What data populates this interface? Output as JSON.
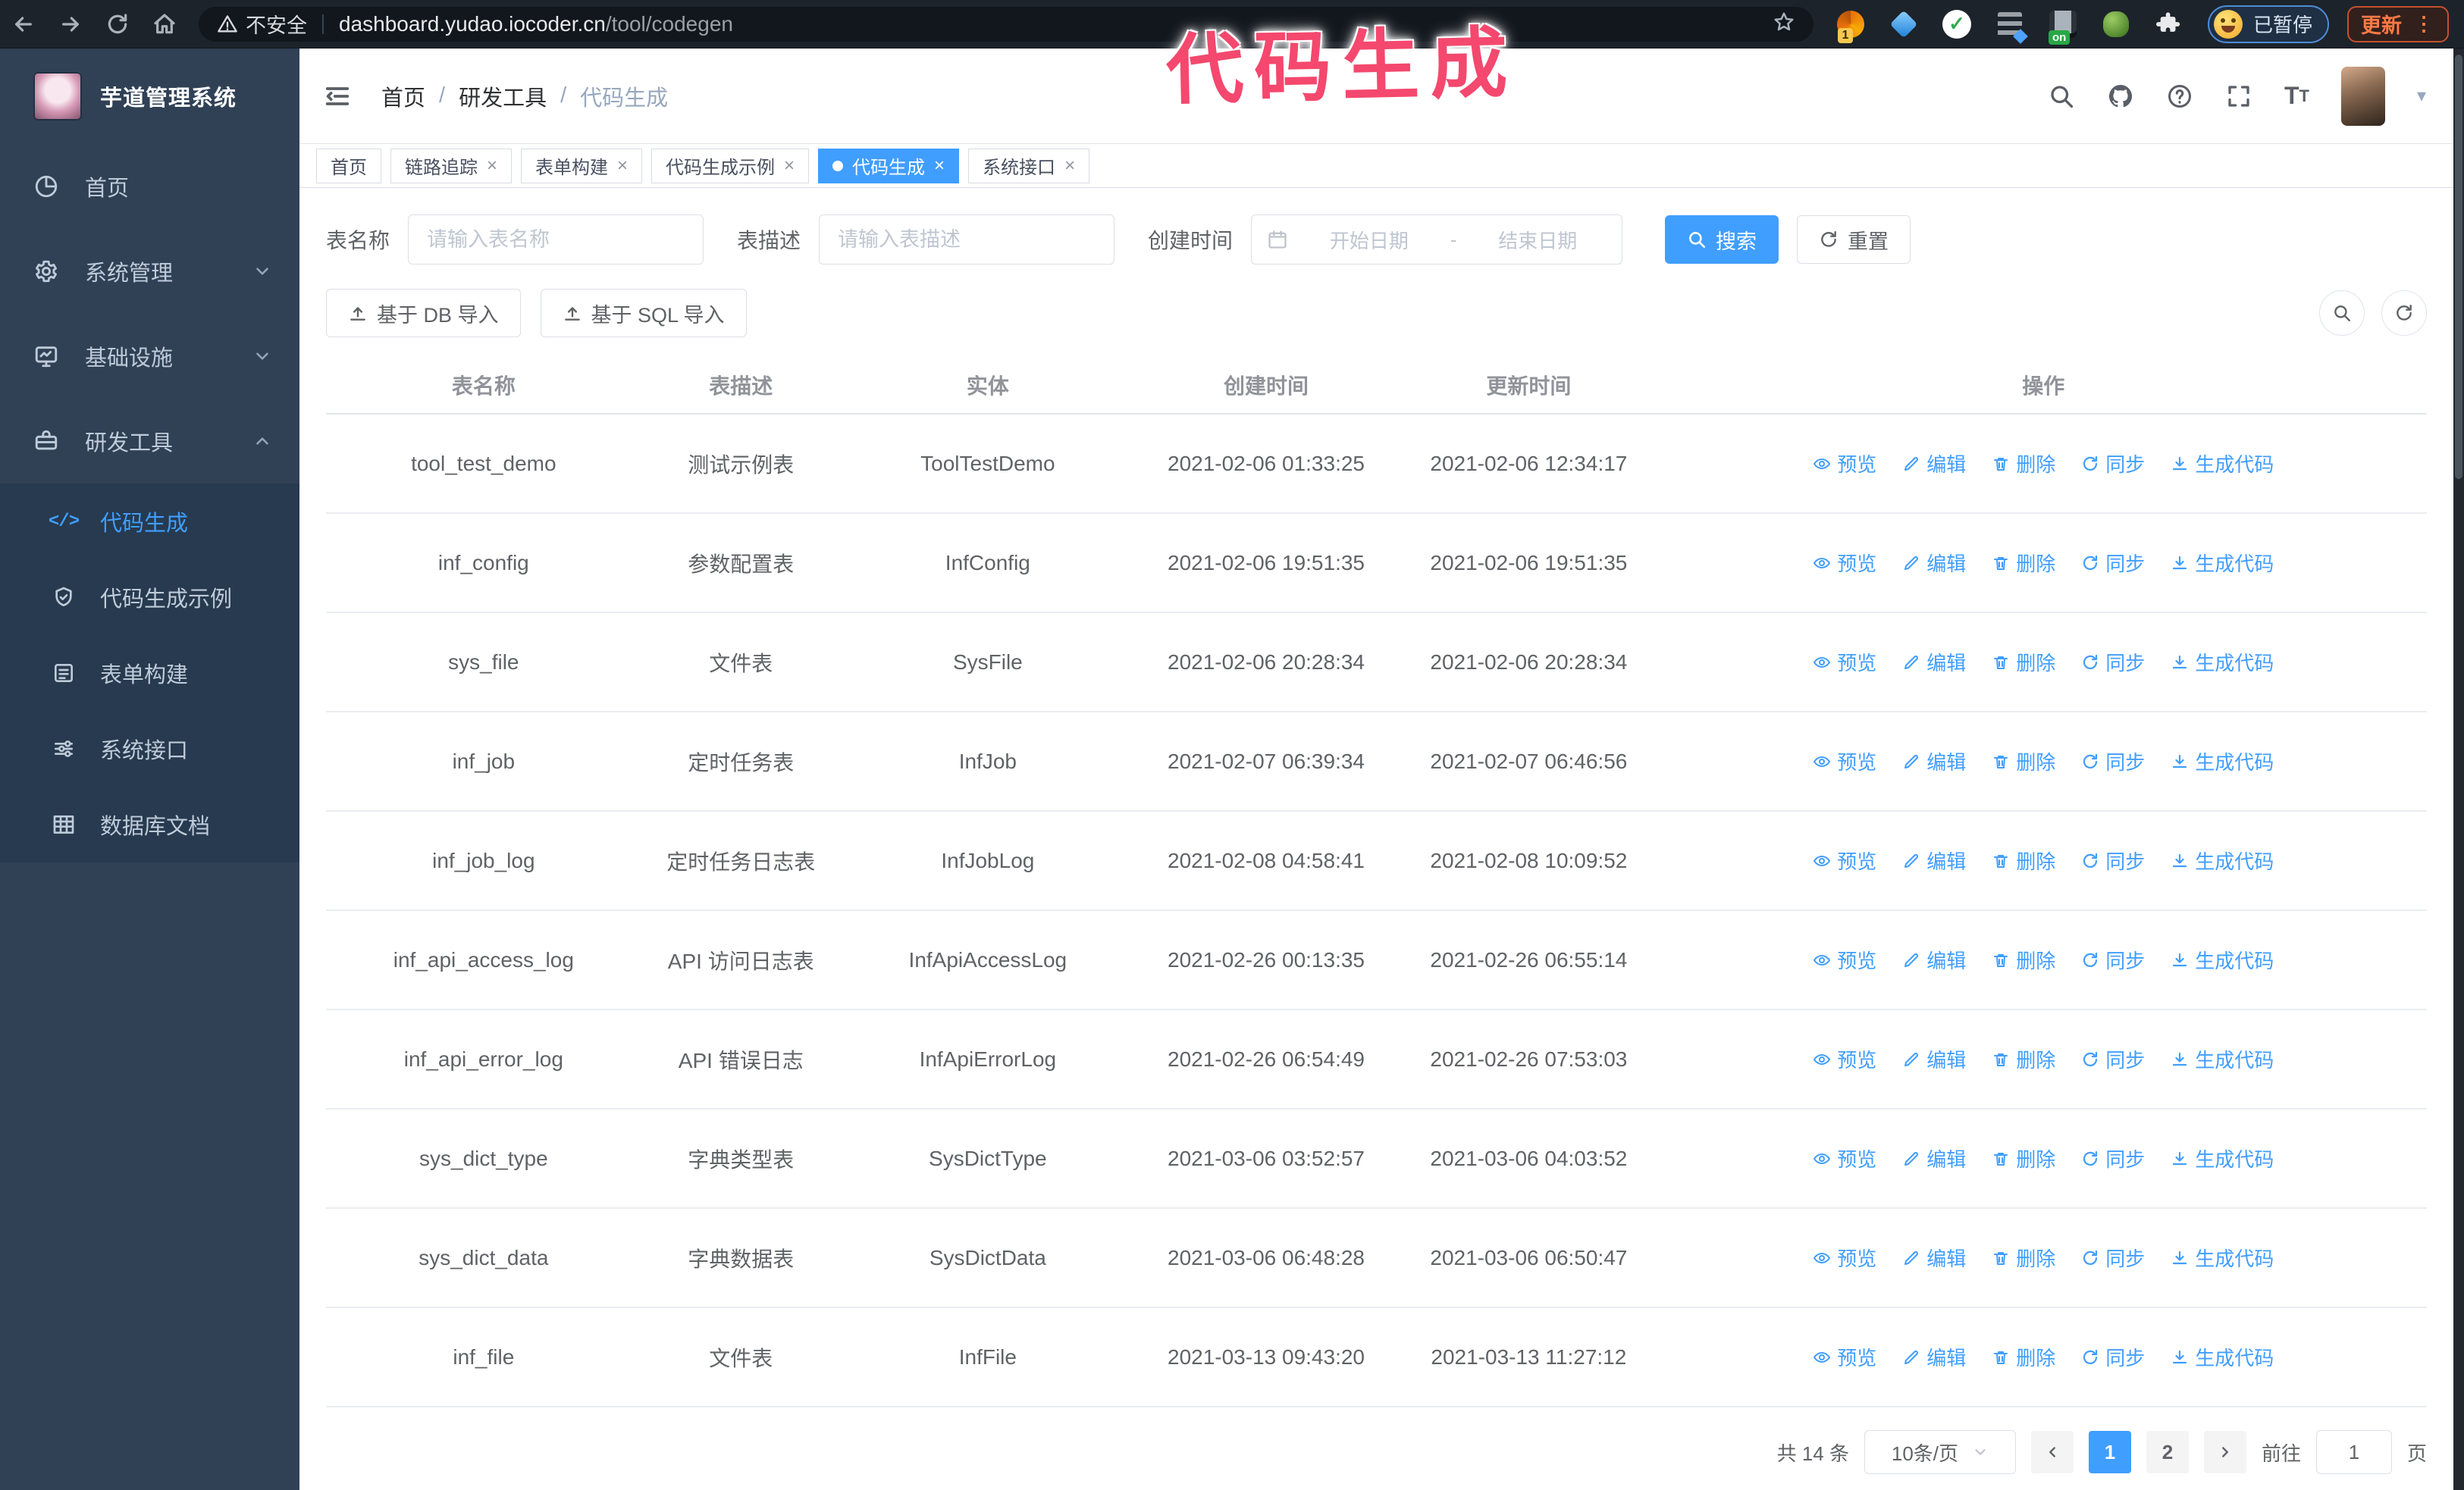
{
  "colors": {
    "accent": "#409eff",
    "sidebar_bg": "#304156",
    "sidebar_submenu_bg": "#273a4f",
    "annotation_pink": "#f4486e",
    "browser_bar_bg": "#1d232b",
    "update_orange": "#ff7a45"
  },
  "browser": {
    "security_label": "不安全",
    "url_domain": "dashboard.yudao.iocoder.cn",
    "url_path": "/tool/codegen",
    "extension_badge_1": "1",
    "extension_badge_on": "on",
    "profile_paused_label": "已暂停",
    "update_label": "更新"
  },
  "annotation": {
    "text": "代码生成"
  },
  "sidebar": {
    "title": "芋道管理系统",
    "items": [
      {
        "label": "首页",
        "icon": "dashboard-icon",
        "expandable": false
      },
      {
        "label": "系统管理",
        "icon": "gear-icon",
        "expandable": true,
        "state": "collapsed"
      },
      {
        "label": "基础设施",
        "icon": "infrastructure-icon",
        "expandable": true,
        "state": "collapsed"
      },
      {
        "label": "研发工具",
        "icon": "tools-icon",
        "expandable": true,
        "state": "expanded"
      }
    ],
    "subitems": [
      {
        "label": "代码生成",
        "icon": "code-icon",
        "active": true
      },
      {
        "label": "代码生成示例",
        "icon": "shield-check-icon",
        "active": false
      },
      {
        "label": "表单构建",
        "icon": "form-icon",
        "active": false
      },
      {
        "label": "系统接口",
        "icon": "api-icon",
        "active": false
      },
      {
        "label": "数据库文档",
        "icon": "database-doc-icon",
        "active": false
      }
    ]
  },
  "navbar": {
    "breadcrumb": {
      "items": [
        "首页",
        "研发工具",
        "代码生成"
      ],
      "separator": "/"
    }
  },
  "tags": [
    {
      "label": "首页",
      "closable": false,
      "active": false
    },
    {
      "label": "链路追踪",
      "closable": true,
      "active": false
    },
    {
      "label": "表单构建",
      "closable": true,
      "active": false
    },
    {
      "label": "代码生成示例",
      "closable": true,
      "active": false
    },
    {
      "label": "代码生成",
      "closable": true,
      "active": true
    },
    {
      "label": "系统接口",
      "closable": true,
      "active": false
    }
  ],
  "filters": {
    "table_name": {
      "label": "表名称",
      "placeholder": "请输入表名称",
      "value": ""
    },
    "table_desc": {
      "label": "表描述",
      "placeholder": "请输入表描述",
      "value": ""
    },
    "create_time": {
      "label": "创建时间",
      "start_placeholder": "开始日期",
      "separator": "-",
      "end_placeholder": "结束日期"
    },
    "search_label": "搜索",
    "reset_label": "重置"
  },
  "toolbar": {
    "import_db_label": "基于 DB 导入",
    "import_sql_label": "基于 SQL 导入"
  },
  "table": {
    "headers": [
      "表名称",
      "表描述",
      "实体",
      "创建时间",
      "更新时间",
      "操作"
    ],
    "actions": [
      {
        "label": "预览",
        "icon": "eye-icon",
        "name": "preview"
      },
      {
        "label": "编辑",
        "icon": "edit-icon",
        "name": "edit"
      },
      {
        "label": "删除",
        "icon": "delete-icon",
        "name": "delete"
      },
      {
        "label": "同步",
        "icon": "sync-icon",
        "name": "sync"
      },
      {
        "label": "生成代码",
        "icon": "download-icon",
        "name": "generate"
      }
    ],
    "rows": [
      {
        "name": "tool_test_demo",
        "desc": "测试示例表",
        "entity": "ToolTestDemo",
        "created": "2021-02-06 01:33:25",
        "updated": "2021-02-06 12:34:17"
      },
      {
        "name": "inf_config",
        "desc": "参数配置表",
        "entity": "InfConfig",
        "created": "2021-02-06 19:51:35",
        "updated": "2021-02-06 19:51:35"
      },
      {
        "name": "sys_file",
        "desc": "文件表",
        "entity": "SysFile",
        "created": "2021-02-06 20:28:34",
        "updated": "2021-02-06 20:28:34"
      },
      {
        "name": "inf_job",
        "desc": "定时任务表",
        "entity": "InfJob",
        "created": "2021-02-07 06:39:34",
        "updated": "2021-02-07 06:46:56"
      },
      {
        "name": "inf_job_log",
        "desc": "定时任务日志表",
        "entity": "InfJobLog",
        "created": "2021-02-08 04:58:41",
        "updated": "2021-02-08 10:09:52"
      },
      {
        "name": "inf_api_access_log",
        "desc": "API 访问日志表",
        "entity": "InfApiAccessLog",
        "created": "2021-02-26 00:13:35",
        "updated": "2021-02-26 06:55:14"
      },
      {
        "name": "inf_api_error_log",
        "desc": "API 错误日志",
        "entity": "InfApiErrorLog",
        "created": "2021-02-26 06:54:49",
        "updated": "2021-02-26 07:53:03"
      },
      {
        "name": "sys_dict_type",
        "desc": "字典类型表",
        "entity": "SysDictType",
        "created": "2021-03-06 03:52:57",
        "updated": "2021-03-06 04:03:52"
      },
      {
        "name": "sys_dict_data",
        "desc": "字典数据表",
        "entity": "SysDictData",
        "created": "2021-03-06 06:48:28",
        "updated": "2021-03-06 06:50:47"
      },
      {
        "name": "inf_file",
        "desc": "文件表",
        "entity": "InfFile",
        "created": "2021-03-13 09:43:20",
        "updated": "2021-03-13 11:27:12"
      }
    ]
  },
  "pagination": {
    "total_label": "共 14 条",
    "page_size_label": "10条/页",
    "pages": [
      "1",
      "2"
    ],
    "active_page": "1",
    "goto_label": "前往",
    "goto_value": "1",
    "goto_suffix": "页"
  }
}
